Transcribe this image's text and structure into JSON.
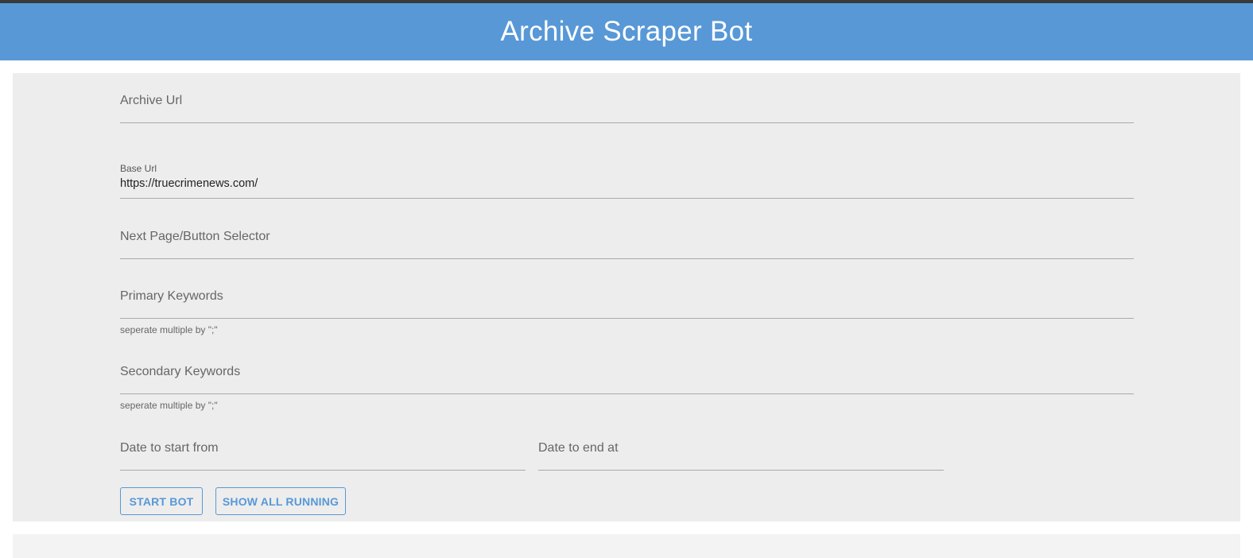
{
  "header": {
    "title": "Archive Scraper Bot"
  },
  "form": {
    "archive_url": {
      "placeholder": "Archive Url",
      "value": ""
    },
    "base_url": {
      "label": "Base Url",
      "value": "https://truecrimenews.com/"
    },
    "next_page_selector": {
      "placeholder": "Next Page/Button Selector",
      "value": ""
    },
    "primary_keywords": {
      "placeholder": "Primary Keywords",
      "value": "",
      "helper": "seperate multiple by \";\""
    },
    "secondary_keywords": {
      "placeholder": "Secondary Keywords",
      "value": "",
      "helper": "seperate multiple by \";\""
    },
    "date_start": {
      "placeholder": "Date to start from",
      "value": ""
    },
    "date_end": {
      "placeholder": "Date to end at",
      "value": ""
    }
  },
  "buttons": {
    "start_bot": "START BOT",
    "show_all_running": "SHOW ALL RUNNING"
  },
  "colors": {
    "header": "#5898d6",
    "accent": "#5898d6",
    "panel": "#ededed"
  }
}
